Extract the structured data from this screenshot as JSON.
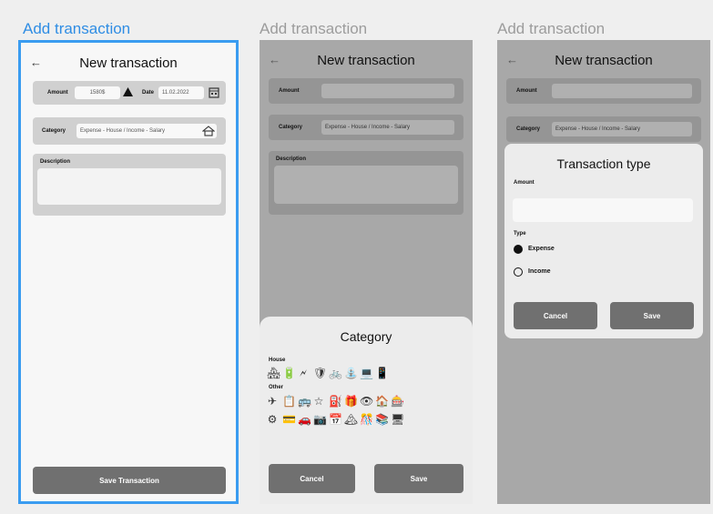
{
  "boards": [
    {
      "title": "Add transaction"
    },
    {
      "title": "Add transaction"
    },
    {
      "title": "Add transaction"
    }
  ],
  "screen1": {
    "back": "←",
    "title": "New transaction",
    "amount_label": "Amount",
    "amount_value": "1580$",
    "date_label": "Date",
    "date_value": "11.02.2022",
    "category_label": "Category",
    "category_value": "Expense - House / Income - Salary",
    "description_label": "Description",
    "save_button": "Save Transaction"
  },
  "screen2": {
    "back": "←",
    "title": "New transaction",
    "amount_label": "Amount",
    "category_label": "Category",
    "category_value": "Expense - House / Income - Salary",
    "description_label": "Description",
    "sheet_title": "Category",
    "group_house": "House",
    "group_other": "Other",
    "house_icons": [
      "🏘",
      "🔋",
      "🗲",
      "🛡",
      "🚲",
      "⛲",
      "💻",
      "📱"
    ],
    "other_icons_row1": [
      "✈",
      "📋",
      "🚌",
      "☆",
      "⛽",
      "🎁",
      "👁",
      "🏠",
      "🎰"
    ],
    "other_icons_row2": [
      "⚙",
      "💳",
      "🚗",
      "📷",
      "📅",
      "🏔",
      "🎊",
      "📚",
      "🖥"
    ],
    "cancel": "Cancel",
    "save": "Save"
  },
  "screen3": {
    "back": "←",
    "title": "New transaction",
    "amount_label": "Amount",
    "category_label": "Category",
    "category_value": "Expense - House / Income - Salary",
    "sheet_title": "Transaction type",
    "sheet_amount_label": "Amount",
    "type_label": "Type",
    "option_expense": "Expense",
    "option_income": "Income",
    "cancel": "Cancel",
    "save": "Save"
  }
}
